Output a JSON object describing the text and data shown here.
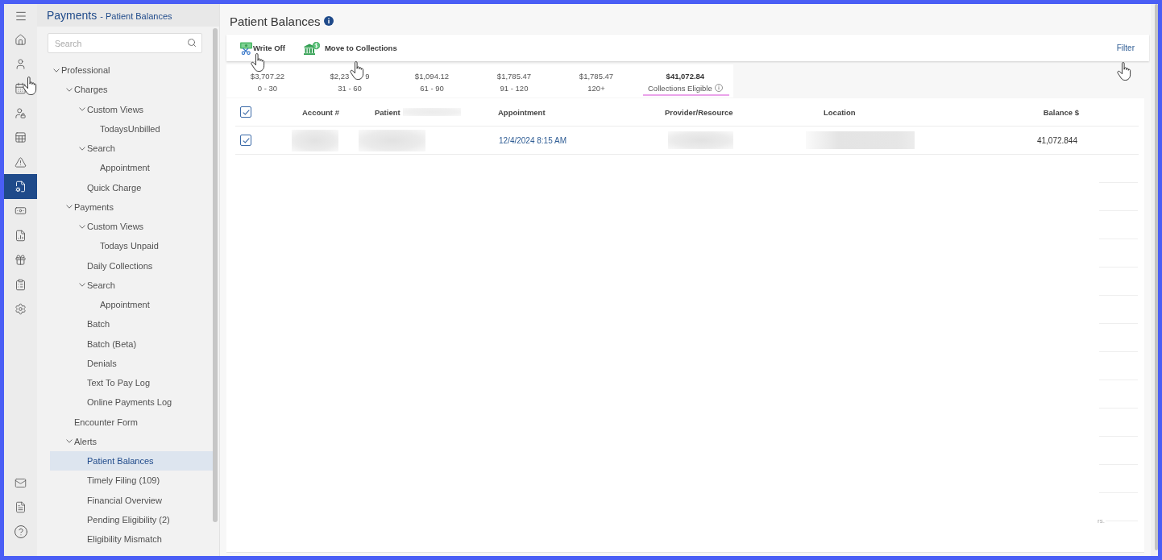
{
  "icon_rail": {
    "items": [
      {
        "selected": false
      },
      {
        "selected": false
      },
      {
        "selected": false
      },
      {
        "selected": false
      },
      {
        "selected": false
      },
      {
        "selected": false
      },
      {
        "selected": true
      },
      {
        "selected": false
      },
      {
        "selected": false
      },
      {
        "selected": false
      },
      {
        "selected": false
      },
      {
        "selected": false
      }
    ]
  },
  "sidebar": {
    "title": "Payments",
    "subtitle": "- Patient Balances",
    "search": {
      "placeholder": "Search"
    },
    "tree": [
      {
        "label": "Professional",
        "selected": false,
        "expanded": true,
        "children": [
          {
            "label": "Charges",
            "selected": false,
            "expanded": true,
            "children": [
              {
                "label": "Custom Views",
                "selected": false,
                "expanded": true,
                "children": [
                  {
                    "label": "TodaysUnbilled",
                    "selected": false
                  }
                ]
              },
              {
                "label": "Search",
                "selected": false,
                "expanded": true,
                "children": [
                  {
                    "label": "Appointment",
                    "selected": false
                  }
                ]
              },
              {
                "label": "Quick Charge",
                "selected": false
              }
            ]
          },
          {
            "label": "Payments",
            "selected": false,
            "expanded": true,
            "children": [
              {
                "label": "Custom Views",
                "selected": false,
                "expanded": true,
                "children": [
                  {
                    "label": "Todays Unpaid",
                    "selected": false
                  }
                ]
              },
              {
                "label": "Daily Collections",
                "selected": false
              },
              {
                "label": "Search",
                "selected": false,
                "expanded": true,
                "children": [
                  {
                    "label": "Appointment",
                    "selected": false
                  }
                ]
              },
              {
                "label": "Batch",
                "selected": false
              },
              {
                "label": "Batch (Beta)",
                "selected": false
              },
              {
                "label": "Denials",
                "selected": false
              },
              {
                "label": "Text To Pay Log",
                "selected": false
              },
              {
                "label": "Online Payments Log",
                "selected": false
              }
            ]
          },
          {
            "label": "Encounter Form",
            "selected": false
          },
          {
            "label": "Alerts",
            "selected": false,
            "expanded": true,
            "children": [
              {
                "label": "Patient Balances",
                "selected": true
              },
              {
                "label": "Timely Filing (109)",
                "selected": false
              },
              {
                "label": "Financial Overview",
                "selected": false
              },
              {
                "label": "Pending Eligibility (2)",
                "selected": false
              },
              {
                "label": "Eligibility Mismatch",
                "selected": false
              }
            ]
          }
        ]
      }
    ]
  },
  "page": {
    "title": "Patient Balances"
  },
  "toolbar": {
    "actions": [
      {
        "label": "Write Off"
      },
      {
        "label": "Move to Collections"
      }
    ],
    "filter": "Filter"
  },
  "aging_buckets": [
    {
      "amount": "$3,707.22",
      "label": "0 - 30",
      "selected": false,
      "info": false
    },
    {
      "amount": "$2,23",
      "amount_tail": "9",
      "label": "31 - 60",
      "selected": false,
      "info": false
    },
    {
      "amount": "$1,094.12",
      "label": "61 - 90",
      "selected": false,
      "info": false
    },
    {
      "amount": "$1,785.47",
      "label": "91 - 120",
      "selected": false,
      "info": false
    },
    {
      "amount": "$1,785.47",
      "label": "120+",
      "selected": false,
      "info": false
    },
    {
      "amount": "$41,072.84",
      "label": "Collections Eligible",
      "selected": true,
      "info": true
    }
  ],
  "table": {
    "select_all": {
      "checked": true
    },
    "columns": [
      "Account #",
      "Patient",
      "Appointment",
      "Provider/Resource",
      "Location",
      "Balance $"
    ],
    "rows": [
      {
        "checked": true,
        "appointment": "12/4/2024 8:15 AM",
        "balance": "41,072.844"
      }
    ]
  },
  "faint_text": "rs."
}
